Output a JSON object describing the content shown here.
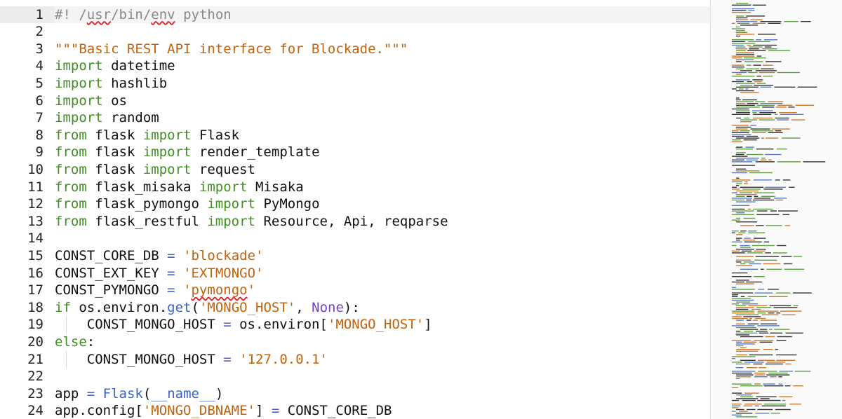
{
  "editor": {
    "active_line": 1,
    "colors": {
      "comment": "#888888",
      "keyword": "#3f8f21",
      "string": "#c1620d",
      "operator": "#4a5fc4",
      "builtin": "#7a3fc6",
      "func": "#3a63c6",
      "plain": "#111111",
      "error_underline": "#e02020"
    },
    "lines": [
      {
        "n": "1",
        "tokens": [
          [
            "comment",
            "#! /"
          ],
          [
            "comment-err",
            "usr"
          ],
          [
            "comment",
            "/bin/"
          ],
          [
            "comment-err",
            "env"
          ],
          [
            "comment",
            " python"
          ]
        ]
      },
      {
        "n": "2",
        "tokens": []
      },
      {
        "n": "3",
        "tokens": [
          [
            "string",
            "\"\"\"Basic REST API interface for Blockade.\"\"\""
          ]
        ]
      },
      {
        "n": "4",
        "tokens": [
          [
            "keyword",
            "import"
          ],
          [
            "plain",
            " datetime"
          ]
        ]
      },
      {
        "n": "5",
        "tokens": [
          [
            "keyword",
            "import"
          ],
          [
            "plain",
            " hashlib"
          ]
        ]
      },
      {
        "n": "6",
        "tokens": [
          [
            "keyword",
            "import"
          ],
          [
            "plain",
            " os"
          ]
        ]
      },
      {
        "n": "7",
        "tokens": [
          [
            "keyword",
            "import"
          ],
          [
            "plain",
            " random"
          ]
        ]
      },
      {
        "n": "8",
        "tokens": [
          [
            "keyword",
            "from"
          ],
          [
            "plain",
            " flask "
          ],
          [
            "keyword",
            "import"
          ],
          [
            "plain",
            " Flask"
          ]
        ]
      },
      {
        "n": "9",
        "tokens": [
          [
            "keyword",
            "from"
          ],
          [
            "plain",
            " flask "
          ],
          [
            "keyword",
            "import"
          ],
          [
            "plain",
            " render_template"
          ]
        ]
      },
      {
        "n": "10",
        "tokens": [
          [
            "keyword",
            "from"
          ],
          [
            "plain",
            " flask "
          ],
          [
            "keyword",
            "import"
          ],
          [
            "plain",
            " request"
          ]
        ]
      },
      {
        "n": "11",
        "tokens": [
          [
            "keyword",
            "from"
          ],
          [
            "plain",
            " flask_misaka "
          ],
          [
            "keyword",
            "import"
          ],
          [
            "plain",
            " Misaka"
          ]
        ]
      },
      {
        "n": "12",
        "tokens": [
          [
            "keyword",
            "from"
          ],
          [
            "plain",
            " flask_pymongo "
          ],
          [
            "keyword",
            "import"
          ],
          [
            "plain",
            " PyMongo"
          ]
        ]
      },
      {
        "n": "13",
        "tokens": [
          [
            "keyword",
            "from"
          ],
          [
            "plain",
            " flask_restful "
          ],
          [
            "keyword",
            "import"
          ],
          [
            "plain",
            " Resource, Api, reqparse"
          ]
        ]
      },
      {
        "n": "14",
        "tokens": []
      },
      {
        "n": "15",
        "tokens": [
          [
            "plain",
            "CONST_CORE_DB "
          ],
          [
            "operator",
            "="
          ],
          [
            "plain",
            " "
          ],
          [
            "string",
            "'blockade'"
          ]
        ]
      },
      {
        "n": "16",
        "tokens": [
          [
            "plain",
            "CONST_EXT_KEY "
          ],
          [
            "operator",
            "="
          ],
          [
            "plain",
            " "
          ],
          [
            "string",
            "'EXTMONGO'"
          ]
        ]
      },
      {
        "n": "17",
        "tokens": [
          [
            "plain",
            "CONST_PYMONGO "
          ],
          [
            "operator",
            "="
          ],
          [
            "plain",
            " "
          ],
          [
            "string",
            "'"
          ],
          [
            "string-err",
            "pymongo"
          ],
          [
            "string",
            "'"
          ]
        ]
      },
      {
        "n": "18",
        "tokens": [
          [
            "keyword",
            "if"
          ],
          [
            "plain",
            " os.environ."
          ],
          [
            "func",
            "get"
          ],
          [
            "plain",
            "("
          ],
          [
            "string",
            "'MONGO_HOST'"
          ],
          [
            "plain",
            ", "
          ],
          [
            "builtin",
            "None"
          ],
          [
            "plain",
            "):"
          ]
        ]
      },
      {
        "n": "19",
        "indent": true,
        "tokens": [
          [
            "plain",
            "    CONST_MONGO_HOST "
          ],
          [
            "operator",
            "="
          ],
          [
            "plain",
            " os.environ["
          ],
          [
            "string",
            "'MONGO_HOST'"
          ],
          [
            "plain",
            "]"
          ]
        ]
      },
      {
        "n": "20",
        "tokens": [
          [
            "keyword",
            "else"
          ],
          [
            "plain",
            ":"
          ]
        ]
      },
      {
        "n": "21",
        "indent": true,
        "tokens": [
          [
            "plain",
            "    CONST_MONGO_HOST "
          ],
          [
            "operator",
            "="
          ],
          [
            "plain",
            " "
          ],
          [
            "string",
            "'127.0.0.1'"
          ]
        ]
      },
      {
        "n": "22",
        "tokens": []
      },
      {
        "n": "23",
        "tokens": [
          [
            "plain",
            "app "
          ],
          [
            "operator",
            "="
          ],
          [
            "plain",
            " "
          ],
          [
            "func",
            "Flask"
          ],
          [
            "plain",
            "("
          ],
          [
            "func",
            "__name__"
          ],
          [
            "plain",
            ")"
          ]
        ]
      },
      {
        "n": "24",
        "tokens": [
          [
            "plain",
            "app.config["
          ],
          [
            "string",
            "'MONGO_DBNAME'"
          ],
          [
            "plain",
            "] "
          ],
          [
            "operator",
            "="
          ],
          [
            "plain",
            " CONST_CORE_DB"
          ]
        ]
      }
    ]
  }
}
